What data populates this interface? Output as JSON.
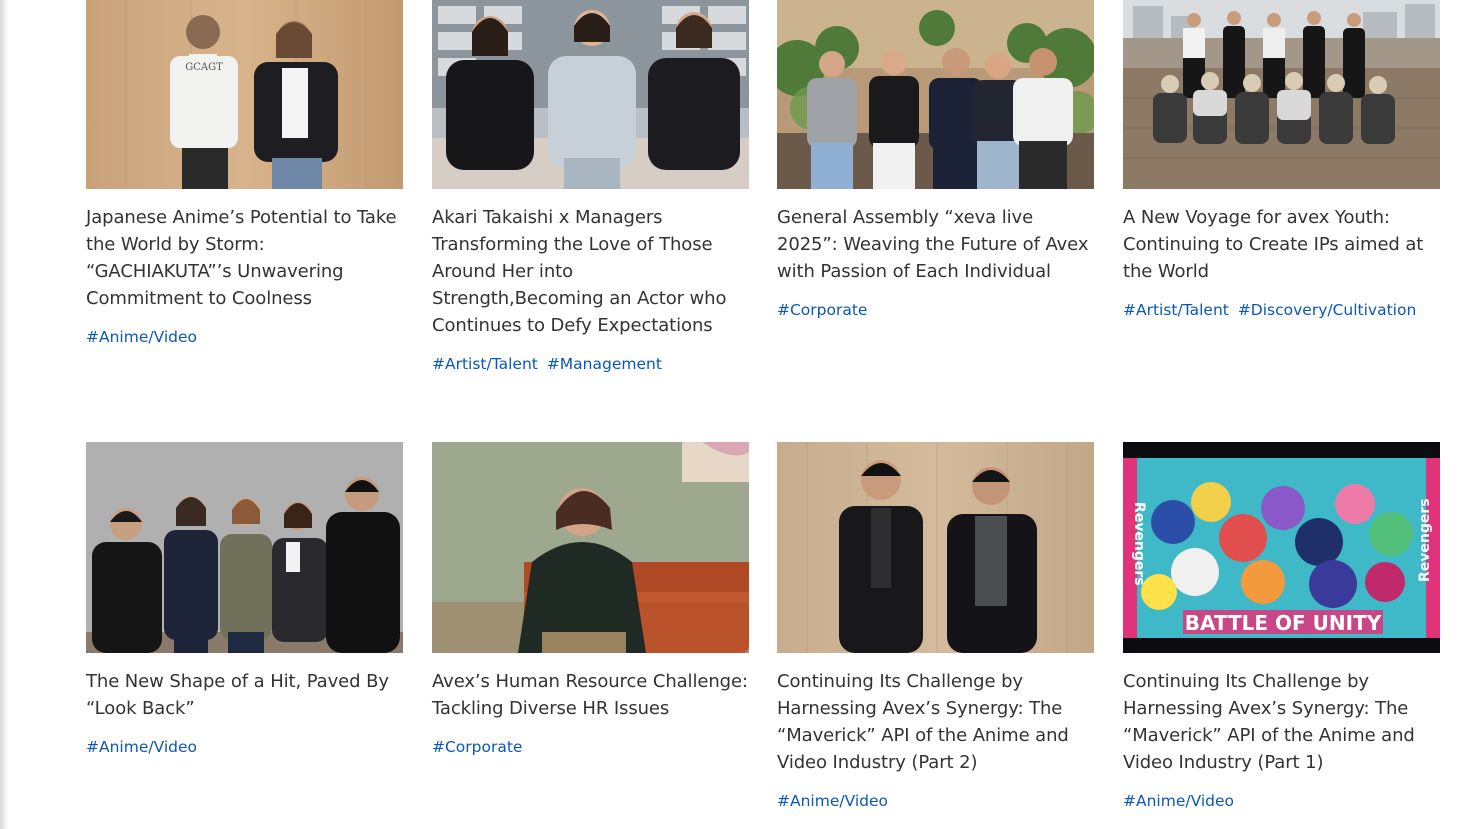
{
  "articles": [
    {
      "title": "Japanese Anime’s Potential to Take the World by Storm: “GACHIAKUTA”’s Unwavering Commitment to Coolness",
      "tags": [
        "#Anime/Video"
      ],
      "image": "two-people-wood-wall-photo"
    },
    {
      "title": "Akari Takaishi x Managers Transforming the Love of Those Around Her into Strength,Becoming an Actor who Continues to Defy Expectations",
      "tags": [
        "#Artist/Talent",
        "#Management"
      ],
      "image": "three-women-sofa-photo"
    },
    {
      "title": "General Assembly “xeva live 2025”: Weaving the Future of Avex with Passion of Each Individual",
      "tags": [
        "#Corporate"
      ],
      "image": "five-people-office-plants-photo"
    },
    {
      "title": "A New Voyage for avex Youth: Continuing to Create IPs aimed at the World",
      "tags": [
        "#Artist/Talent",
        "#Discovery/Cultivation"
      ],
      "image": "group-rooftop-photo"
    },
    {
      "title": "The New Shape of a Hit, Paved By “Look Back”",
      "tags": [
        "#Anime/Video"
      ],
      "image": "five-people-gray-wall-photo"
    },
    {
      "title": "Avex’s Human Resource Challenge: Tackling Diverse HR Issues",
      "tags": [
        "#Corporate"
      ],
      "image": "woman-orange-sofa-photo"
    },
    {
      "title": "Continuing Its Challenge by Harnessing Avex’s Synergy: The “Maverick” API of the Anime and Video Industry (Part 2)",
      "tags": [
        "#Anime/Video"
      ],
      "image": "two-men-wood-wall-photo"
    },
    {
      "title": "Continuing Its Challenge by Harnessing Avex’s Synergy: The “Maverick” API of the Anime and Video Industry (Part 1)",
      "tags": [
        "#Anime/Video"
      ],
      "image": "anime-key-visual",
      "image_text": "BATTLE OF UNITY",
      "image_side_text": "Revengers"
    }
  ],
  "colors": {
    "title": "#333333",
    "tag": "#0a58b8",
    "background": "#ffffff"
  }
}
